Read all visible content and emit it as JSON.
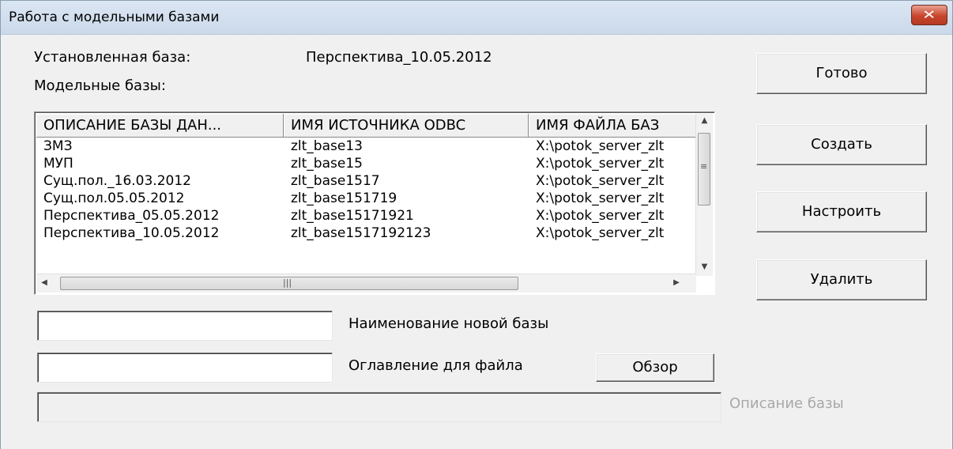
{
  "window": {
    "title": "Работа с модельными базами",
    "close_icon": "✕"
  },
  "labels": {
    "installed_base_label": "Установленная база:",
    "installed_base_value": "Перспектива_10.05.2012",
    "model_bases_label": "Модельные базы:",
    "new_base_name_label": "Наименование новой базы",
    "file_directory_label": "Оглавление для файла",
    "base_description_label": "Описание базы"
  },
  "buttons": {
    "done": "Готово",
    "create": "Создать",
    "configure": "Настроить",
    "delete": "Удалить",
    "browse": "Обзор"
  },
  "table": {
    "columns": [
      "ОПИСАНИЕ БАЗЫ ДАН...",
      "ИМЯ ИСТОЧНИКА ODBC",
      "ИМЯ ФАЙЛА БАЗ"
    ],
    "rows": [
      [
        "ЗМЗ",
        "zlt_base13",
        "X:\\potok_server_zlt"
      ],
      [
        "МУП",
        "zlt_base15",
        "X:\\potok_server_zlt"
      ],
      [
        "Сущ.пол._16.03.2012",
        "zlt_base1517",
        "X:\\potok_server_zlt"
      ],
      [
        "Сущ.пол.05.05.2012",
        "zlt_base151719",
        "X:\\potok_server_zlt"
      ],
      [
        "Перспектива_05.05.2012",
        "zlt_base15171921",
        "X:\\potok_server_zlt"
      ],
      [
        "Перспектива_10.05.2012",
        "zlt_base1517192123",
        "X:\\potok_server_zlt"
      ]
    ]
  },
  "inputs": {
    "new_base_name": "",
    "file_directory": "",
    "base_description": ""
  },
  "icons": {
    "scroll_up": "▲",
    "scroll_down": "▼",
    "scroll_left": "◀",
    "scroll_right": "▶",
    "vgrip": "≡",
    "hgrip": "|||"
  },
  "colors": {
    "close_button": "#c9452c",
    "disabled_text": "#a8a8a8"
  }
}
